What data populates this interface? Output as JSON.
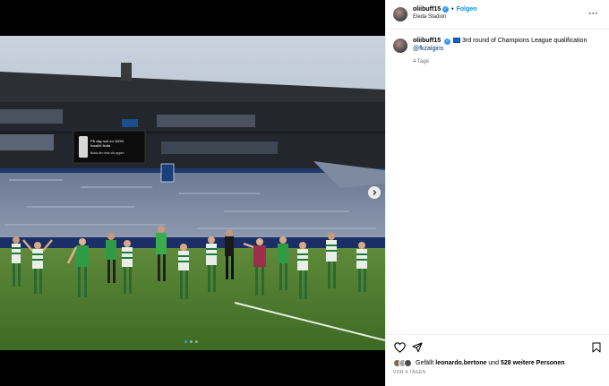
{
  "post": {
    "username": "oliibuff15",
    "follow_label": "Folgen",
    "separator": "•",
    "location": "Eleda Stadion",
    "more_label": "···"
  },
  "caption": {
    "username": "oliibuff15",
    "text": "3rd round of Champions League qualification",
    "mention": "@fkzalgiris",
    "time_ago": "4 Tage"
  },
  "media": {
    "carousel_count": 3,
    "carousel_active": 0,
    "scoreboard_line1": "På väg mot en 100%",
    "scoreboard_line2": "fossilfri flotta",
    "scoreboard_line3": "Boka din resa via appen"
  },
  "likes": {
    "prefix": "Gefällt",
    "user": "leonardo.bertone",
    "conjunction": "und",
    "others": "528 weitere Personen"
  },
  "date_label": "VOR 4 TAGEN",
  "colors": {
    "accent": "#0095f6",
    "verified": "#3897f0",
    "mention": "#00376b",
    "muted": "#737373"
  },
  "icons": {
    "like": "heart-icon",
    "share": "paper-plane-icon",
    "save": "bookmark-icon",
    "more": "more-horizontal-icon",
    "next": "chevron-right-icon"
  }
}
